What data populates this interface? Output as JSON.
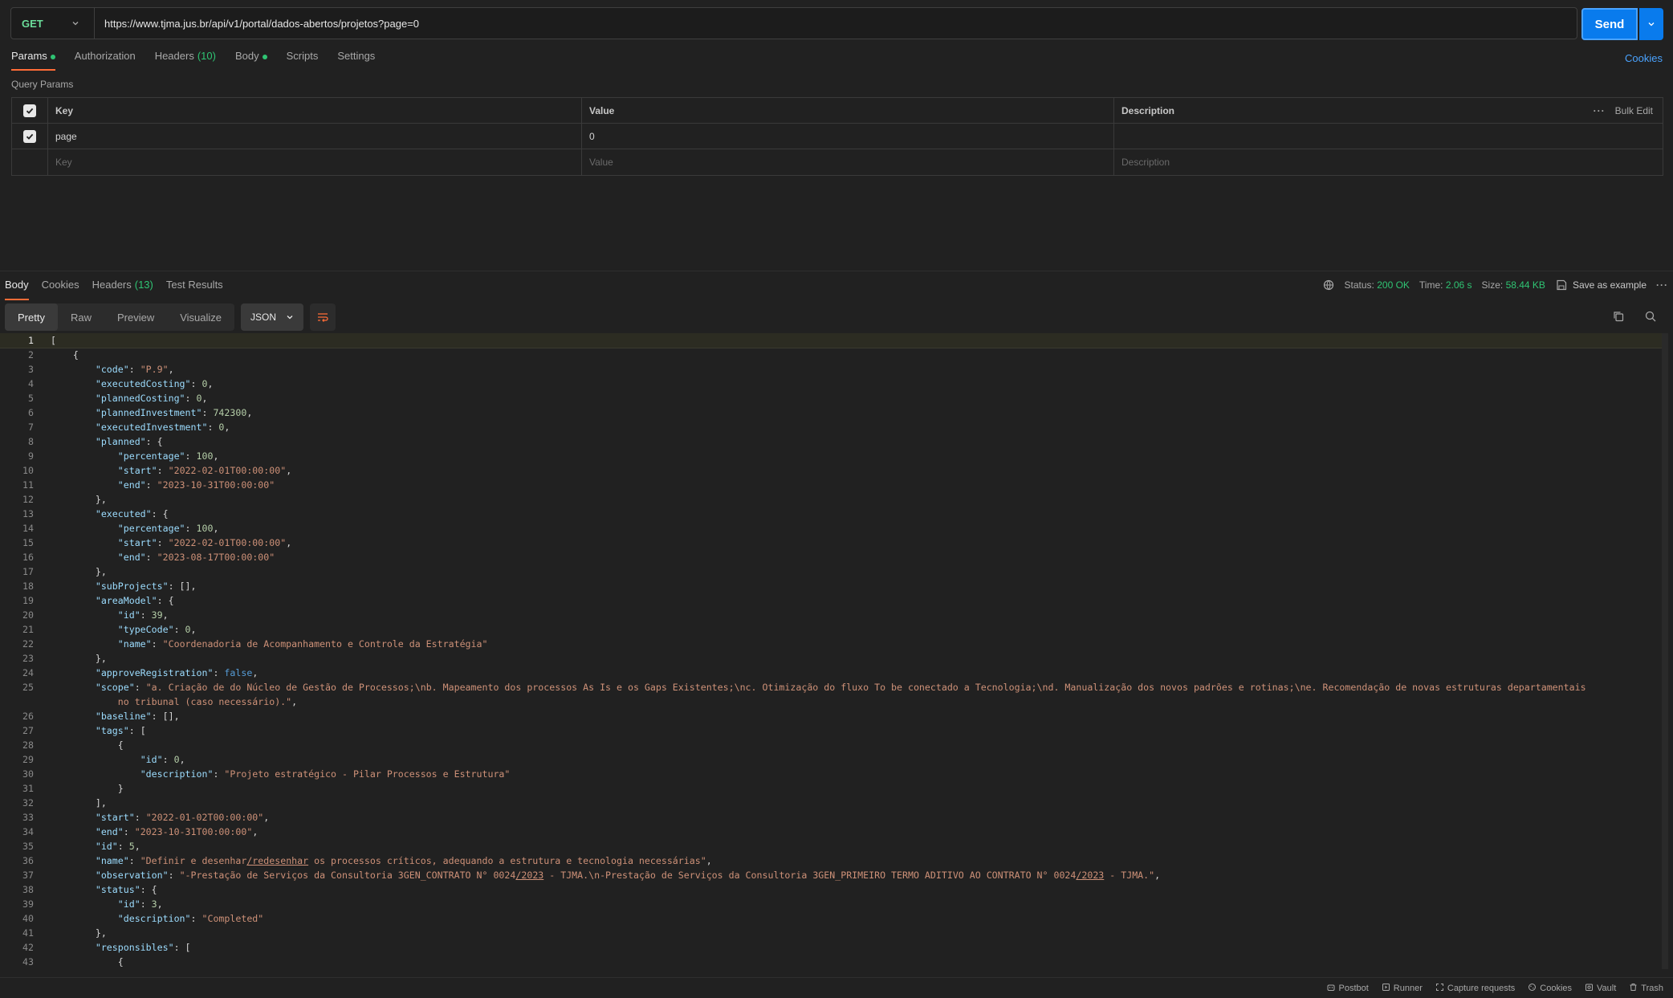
{
  "request": {
    "method": "GET",
    "url": "https://www.tjma.jus.br/api/v1/portal/dados-abertos/projetos?page=0",
    "send_label": "Send",
    "tabs": [
      {
        "label": "Params",
        "active": true,
        "dot": true
      },
      {
        "label": "Authorization"
      },
      {
        "label": "Headers",
        "count": "(10)"
      },
      {
        "label": "Body",
        "dot": true
      },
      {
        "label": "Scripts"
      },
      {
        "label": "Settings"
      }
    ],
    "cookies_label": "Cookies",
    "query_params_label": "Query Params",
    "table": {
      "headers": {
        "key": "Key",
        "value": "Value",
        "description": "Description",
        "bulk_edit": "Bulk Edit"
      },
      "rows": [
        {
          "key": "page",
          "value": "0",
          "description": "",
          "checked": true
        }
      ],
      "placeholder": {
        "key": "Key",
        "value": "Value",
        "description": "Description"
      }
    }
  },
  "response": {
    "tabs": [
      {
        "label": "Body",
        "active": true
      },
      {
        "label": "Cookies"
      },
      {
        "label": "Headers",
        "count": "(13)"
      },
      {
        "label": "Test Results"
      }
    ],
    "status_label": "Status:",
    "status_value": "200 OK",
    "time_label": "Time:",
    "time_value": "2.06 s",
    "size_label": "Size:",
    "size_value": "58.44 KB",
    "save_example": "Save as example",
    "views": [
      "Pretty",
      "Raw",
      "Preview",
      "Visualize"
    ],
    "active_view": "Pretty",
    "format": "JSON"
  },
  "code_lines": [
    {
      "n": "1",
      "i": 0,
      "t": [
        [
          "p",
          "["
        ]
      ]
    },
    {
      "n": "2",
      "i": 1,
      "t": [
        [
          "p",
          "{"
        ]
      ]
    },
    {
      "n": "3",
      "i": 2,
      "t": [
        [
          "k",
          "\"code\""
        ],
        [
          "p",
          ": "
        ],
        [
          "s",
          "\"P.9\""
        ],
        [
          "p",
          ","
        ]
      ]
    },
    {
      "n": "4",
      "i": 2,
      "t": [
        [
          "k",
          "\"executedCosting\""
        ],
        [
          "p",
          ": "
        ],
        [
          "n",
          "0"
        ],
        [
          "p",
          ","
        ]
      ]
    },
    {
      "n": "5",
      "i": 2,
      "t": [
        [
          "k",
          "\"plannedCosting\""
        ],
        [
          "p",
          ": "
        ],
        [
          "n",
          "0"
        ],
        [
          "p",
          ","
        ]
      ]
    },
    {
      "n": "6",
      "i": 2,
      "t": [
        [
          "k",
          "\"plannedInvestment\""
        ],
        [
          "p",
          ": "
        ],
        [
          "n",
          "742300"
        ],
        [
          "p",
          ","
        ]
      ]
    },
    {
      "n": "7",
      "i": 2,
      "t": [
        [
          "k",
          "\"executedInvestment\""
        ],
        [
          "p",
          ": "
        ],
        [
          "n",
          "0"
        ],
        [
          "p",
          ","
        ]
      ]
    },
    {
      "n": "8",
      "i": 2,
      "t": [
        [
          "k",
          "\"planned\""
        ],
        [
          "p",
          ": {"
        ]
      ]
    },
    {
      "n": "9",
      "i": 3,
      "t": [
        [
          "k",
          "\"percentage\""
        ],
        [
          "p",
          ": "
        ],
        [
          "n",
          "100"
        ],
        [
          "p",
          ","
        ]
      ]
    },
    {
      "n": "10",
      "i": 3,
      "t": [
        [
          "k",
          "\"start\""
        ],
        [
          "p",
          ": "
        ],
        [
          "s",
          "\"2022-02-01T00:00:00\""
        ],
        [
          "p",
          ","
        ]
      ]
    },
    {
      "n": "11",
      "i": 3,
      "t": [
        [
          "k",
          "\"end\""
        ],
        [
          "p",
          ": "
        ],
        [
          "s",
          "\"2023-10-31T00:00:00\""
        ]
      ]
    },
    {
      "n": "12",
      "i": 2,
      "t": [
        [
          "p",
          "},"
        ]
      ]
    },
    {
      "n": "13",
      "i": 2,
      "t": [
        [
          "k",
          "\"executed\""
        ],
        [
          "p",
          ": {"
        ]
      ]
    },
    {
      "n": "14",
      "i": 3,
      "t": [
        [
          "k",
          "\"percentage\""
        ],
        [
          "p",
          ": "
        ],
        [
          "n",
          "100"
        ],
        [
          "p",
          ","
        ]
      ]
    },
    {
      "n": "15",
      "i": 3,
      "t": [
        [
          "k",
          "\"start\""
        ],
        [
          "p",
          ": "
        ],
        [
          "s",
          "\"2022-02-01T00:00:00\""
        ],
        [
          "p",
          ","
        ]
      ]
    },
    {
      "n": "16",
      "i": 3,
      "t": [
        [
          "k",
          "\"end\""
        ],
        [
          "p",
          ": "
        ],
        [
          "s",
          "\"2023-08-17T00:00:00\""
        ]
      ]
    },
    {
      "n": "17",
      "i": 2,
      "t": [
        [
          "p",
          "},"
        ]
      ]
    },
    {
      "n": "18",
      "i": 2,
      "t": [
        [
          "k",
          "\"subProjects\""
        ],
        [
          "p",
          ": [],"
        ]
      ]
    },
    {
      "n": "19",
      "i": 2,
      "t": [
        [
          "k",
          "\"areaModel\""
        ],
        [
          "p",
          ": {"
        ]
      ]
    },
    {
      "n": "20",
      "i": 3,
      "t": [
        [
          "k",
          "\"id\""
        ],
        [
          "p",
          ": "
        ],
        [
          "n",
          "39"
        ],
        [
          "p",
          ","
        ]
      ]
    },
    {
      "n": "21",
      "i": 3,
      "t": [
        [
          "k",
          "\"typeCode\""
        ],
        [
          "p",
          ": "
        ],
        [
          "n",
          "0"
        ],
        [
          "p",
          ","
        ]
      ]
    },
    {
      "n": "22",
      "i": 3,
      "t": [
        [
          "k",
          "\"name\""
        ],
        [
          "p",
          ": "
        ],
        [
          "s",
          "\"Coordenadoria de Acompanhamento e Controle da Estratégia\""
        ]
      ]
    },
    {
      "n": "23",
      "i": 2,
      "t": [
        [
          "p",
          "},"
        ]
      ]
    },
    {
      "n": "24",
      "i": 2,
      "t": [
        [
          "k",
          "\"approveRegistration\""
        ],
        [
          "p",
          ": "
        ],
        [
          "b",
          "false"
        ],
        [
          "p",
          ","
        ]
      ]
    },
    {
      "n": "25",
      "i": 2,
      "t": [
        [
          "k",
          "\"scope\""
        ],
        [
          "p",
          ": "
        ],
        [
          "s",
          "\"a. Criação de do Núcleo de Gestão de Processos;\\nb. Mapeamento dos processos As Is e os Gaps Existentes;\\nc. Otimização do fluxo To be conectado a Tecnologia;\\nd. Manualização dos novos padrões e rotinas;\\ne. Recomendação de novas estruturas departamentais"
        ]
      ]
    },
    {
      "n": "",
      "i": 3,
      "t": [
        [
          "s",
          "no tribunal (caso necessário).\""
        ],
        [
          "p",
          ","
        ]
      ]
    },
    {
      "n": "26",
      "i": 2,
      "t": [
        [
          "k",
          "\"baseline\""
        ],
        [
          "p",
          ": [],"
        ]
      ]
    },
    {
      "n": "27",
      "i": 2,
      "t": [
        [
          "k",
          "\"tags\""
        ],
        [
          "p",
          ": ["
        ]
      ]
    },
    {
      "n": "28",
      "i": 3,
      "t": [
        [
          "p",
          "{"
        ]
      ]
    },
    {
      "n": "29",
      "i": 4,
      "t": [
        [
          "k",
          "\"id\""
        ],
        [
          "p",
          ": "
        ],
        [
          "n",
          "0"
        ],
        [
          "p",
          ","
        ]
      ]
    },
    {
      "n": "30",
      "i": 4,
      "t": [
        [
          "k",
          "\"description\""
        ],
        [
          "p",
          ": "
        ],
        [
          "s",
          "\"Projeto estratégico - Pilar Processos e Estrutura\""
        ]
      ]
    },
    {
      "n": "31",
      "i": 3,
      "t": [
        [
          "p",
          "}"
        ]
      ]
    },
    {
      "n": "32",
      "i": 2,
      "t": [
        [
          "p",
          "],"
        ]
      ]
    },
    {
      "n": "33",
      "i": 2,
      "t": [
        [
          "k",
          "\"start\""
        ],
        [
          "p",
          ": "
        ],
        [
          "s",
          "\"2022-01-02T00:00:00\""
        ],
        [
          "p",
          ","
        ]
      ]
    },
    {
      "n": "34",
      "i": 2,
      "t": [
        [
          "k",
          "\"end\""
        ],
        [
          "p",
          ": "
        ],
        [
          "s",
          "\"2023-10-31T00:00:00\""
        ],
        [
          "p",
          ","
        ]
      ]
    },
    {
      "n": "35",
      "i": 2,
      "t": [
        [
          "k",
          "\"id\""
        ],
        [
          "p",
          ": "
        ],
        [
          "n",
          "5"
        ],
        [
          "p",
          ","
        ]
      ]
    },
    {
      "n": "36",
      "i": 2,
      "t": [
        [
          "k",
          "\"name\""
        ],
        [
          "p",
          ": "
        ],
        [
          "s",
          "\"Definir e desenhar"
        ],
        [
          "su",
          "/redesenhar"
        ],
        [
          "s",
          " os processos críticos, adequando a estrutura e tecnologia necessárias\""
        ],
        [
          "p",
          ","
        ]
      ]
    },
    {
      "n": "37",
      "i": 2,
      "t": [
        [
          "k",
          "\"observation\""
        ],
        [
          "p",
          ": "
        ],
        [
          "s",
          "\"-Prestação de Serviços da Consultoria 3GEN_CONTRATO N° 0024"
        ],
        [
          "su",
          "/2023"
        ],
        [
          "s",
          " - TJMA.\\n-Prestação de Serviços da Consultoria 3GEN_PRIMEIRO TERMO ADITIVO AO CONTRATO N° 0024"
        ],
        [
          "su",
          "/2023"
        ],
        [
          "s",
          " - TJMA.\""
        ],
        [
          "p",
          ","
        ]
      ]
    },
    {
      "n": "38",
      "i": 2,
      "t": [
        [
          "k",
          "\"status\""
        ],
        [
          "p",
          ": {"
        ]
      ]
    },
    {
      "n": "39",
      "i": 3,
      "t": [
        [
          "k",
          "\"id\""
        ],
        [
          "p",
          ": "
        ],
        [
          "n",
          "3"
        ],
        [
          "p",
          ","
        ]
      ]
    },
    {
      "n": "40",
      "i": 3,
      "t": [
        [
          "k",
          "\"description\""
        ],
        [
          "p",
          ": "
        ],
        [
          "s",
          "\"Completed\""
        ]
      ]
    },
    {
      "n": "41",
      "i": 2,
      "t": [
        [
          "p",
          "},"
        ]
      ]
    },
    {
      "n": "42",
      "i": 2,
      "t": [
        [
          "k",
          "\"responsibles\""
        ],
        [
          "p",
          ": ["
        ]
      ]
    },
    {
      "n": "43",
      "i": 3,
      "t": [
        [
          "p",
          "{"
        ]
      ]
    }
  ],
  "statusbar": [
    {
      "icon": "postbot-icon",
      "label": "Postbot"
    },
    {
      "icon": "runner-icon",
      "label": "Runner"
    },
    {
      "icon": "capture-icon",
      "label": "Capture requests"
    },
    {
      "icon": "cookie-icon",
      "label": "Cookies"
    },
    {
      "icon": "vault-icon",
      "label": "Vault"
    },
    {
      "icon": "trash-icon",
      "label": "Trash"
    }
  ]
}
